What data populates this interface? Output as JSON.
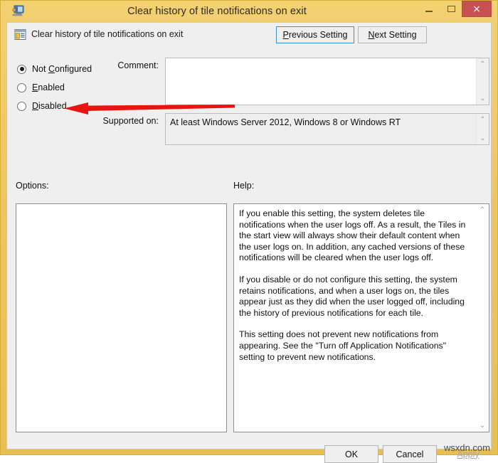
{
  "window": {
    "title": "Clear history of tile notifications on exit",
    "app_icon": "computer-monitor-icon",
    "controls": {
      "minimize": "minimize-icon",
      "maximize": "maximize-icon",
      "close": "×"
    },
    "close_color": "#c75050",
    "frame_color": "#ecc55f"
  },
  "header": {
    "setting_icon": "policy-setting-icon",
    "setting_title": "Clear history of tile notifications on exit",
    "previous_button": {
      "pre": "P",
      "accel": "",
      "rest": "revious Setting",
      "label": "Previous Setting"
    },
    "next_button": {
      "pre": "N",
      "rest": "ext Setting",
      "label": "Next Setting"
    }
  },
  "state": {
    "options": [
      {
        "id": "not-configured",
        "pre": "Not ",
        "accel": "C",
        "rest": "onfigured",
        "label": "Not Configured",
        "selected": true
      },
      {
        "id": "enabled",
        "pre": "",
        "accel": "E",
        "rest": "nabled",
        "label": "Enabled",
        "selected": false
      },
      {
        "id": "disabled",
        "pre": "",
        "accel": "D",
        "rest": "isabled",
        "label": "Disabled",
        "selected": false
      }
    ]
  },
  "comment": {
    "label": "Comment:",
    "value": "",
    "scroll_up": "⌃",
    "scroll_down": "⌄"
  },
  "supported": {
    "label": "Supported on:",
    "value": "At least Windows Server 2012, Windows 8 or Windows RT",
    "scroll_up": "⌃",
    "scroll_down": "⌄"
  },
  "sections": {
    "options_label": "Options:",
    "help_label": "Help:"
  },
  "options_panel": {
    "content": ""
  },
  "help": {
    "paragraphs": [
      "If you enable this setting, the system deletes tile notifications when the user logs off. As a result, the Tiles in the start view will always show their default content when the user logs on. In addition, any cached versions of these notifications will be cleared when the user logs off.",
      "If you disable or do not configure this setting, the system retains notifications, and when a user logs on, the tiles appear just as they did when the user logged off, including the history of previous notifications for each tile.",
      "This setting does not prevent new notifications from appearing. See the \"Turn off Application Notifications\" setting to prevent new notifications."
    ],
    "scroll_up": "⌃",
    "scroll_down": "⌄"
  },
  "footer": {
    "ok": "OK",
    "cancel": "Cancel",
    "apply": "Apply",
    "apply_disabled": true
  },
  "annotation": {
    "type": "arrow",
    "color": "#e8140f",
    "direction": "left",
    "points_to": "Enabled"
  },
  "watermark": "wsxdn.com"
}
